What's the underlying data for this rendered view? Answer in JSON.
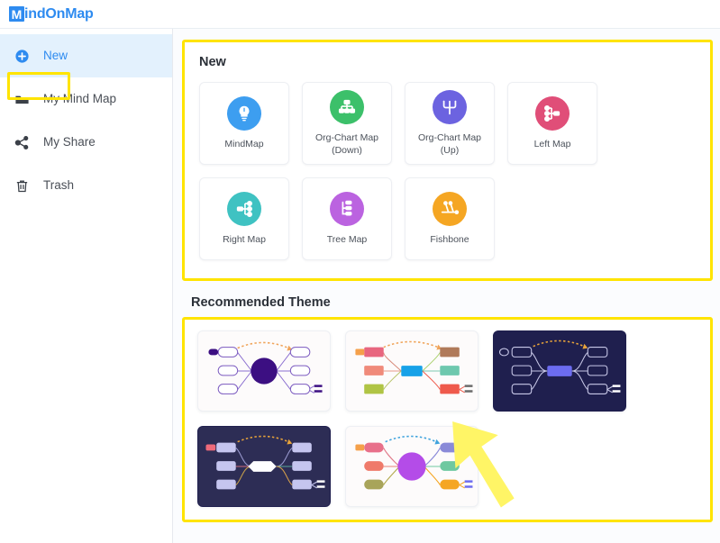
{
  "header": {
    "logo_mark": "M",
    "logo_text": "indOnMap",
    "brand_color": "#2e8bf0"
  },
  "sidebar": {
    "items": [
      {
        "label": "New",
        "icon": "plus-circle-icon",
        "active": true
      },
      {
        "label": "My Mind Map",
        "icon": "folder-icon",
        "active": false
      },
      {
        "label": "My Share",
        "icon": "share-icon",
        "active": false
      },
      {
        "label": "Trash",
        "icon": "trash-icon",
        "active": false
      }
    ],
    "highlight_color": "#ffe400",
    "active_bg": "#e3f1fd"
  },
  "new_section": {
    "title": "New",
    "highlight_color": "#ffe400",
    "cards": [
      {
        "label": "MindMap",
        "icon": "lightbulb-icon",
        "color": "#3d9ef0"
      },
      {
        "label": "Org-Chart Map (Down)",
        "icon": "org-chart-down-icon",
        "color": "#3cc06a"
      },
      {
        "label": "Org-Chart Map (Up)",
        "icon": "org-chart-up-icon",
        "color": "#6c63e0"
      },
      {
        "label": "Left Map",
        "icon": "left-map-icon",
        "color": "#e04e78"
      },
      {
        "label": "Right Map",
        "icon": "right-map-icon",
        "color": "#3fc2c2"
      },
      {
        "label": "Tree Map",
        "icon": "tree-map-icon",
        "color": "#bb63e0"
      },
      {
        "label": "Fishbone",
        "icon": "fishbone-icon",
        "color": "#f5a623"
      }
    ]
  },
  "theme_section": {
    "title": "Recommended Theme",
    "highlight_color": "#ffe400",
    "themes": [
      {
        "name": "theme-purple-light",
        "style": "light",
        "bg": "#fdfbfb",
        "center": "#3c0f82",
        "center_shape": "circle",
        "node_fill": "#ffffff",
        "node_stroke": "#7c5bc0",
        "line": "#8b6fd0",
        "arrow": "#f0a45a",
        "accent": "#3c0f82"
      },
      {
        "name": "theme-colorful-light",
        "style": "light",
        "bg": "#fdfbfb",
        "center": "#17a2e8",
        "center_shape": "rect",
        "node_fill": "#ffffff",
        "node_stroke": "#dddddd",
        "line": "#c9b7a8",
        "arrow": "#f0a45a",
        "accent": "#ef5a4c"
      },
      {
        "name": "theme-navy-blue",
        "style": "dark",
        "bg": "#1f1f4e",
        "center": "#6c6cf0",
        "center_shape": "rect",
        "node_fill": "#1f1f4e",
        "node_stroke": "#c8c8e8",
        "line": "#c8c8e8",
        "arrow": "#e8a33a",
        "accent": "#6c6cf0"
      },
      {
        "name": "theme-navy-white",
        "style": "dark",
        "bg": "#2d2d55",
        "center": "#ffffff",
        "center_shape": "hex",
        "node_fill": "#c5c5ef",
        "node_stroke": "#c5c5ef",
        "line": "#9a9ad0",
        "arrow": "#e8a33a",
        "accent": "#ef6a7a"
      },
      {
        "name": "theme-violet-light",
        "style": "light",
        "bg": "#fdfbfb",
        "center": "#b44ce8",
        "center_shape": "circle",
        "node_fill": "#ffffff",
        "node_stroke": "#dddddd",
        "line": "#c9b7a8",
        "arrow": "#3fa3dd",
        "accent": "#f5a623"
      }
    ]
  },
  "cursor": {
    "name": "arrow-cursor",
    "color": "#fff566"
  }
}
